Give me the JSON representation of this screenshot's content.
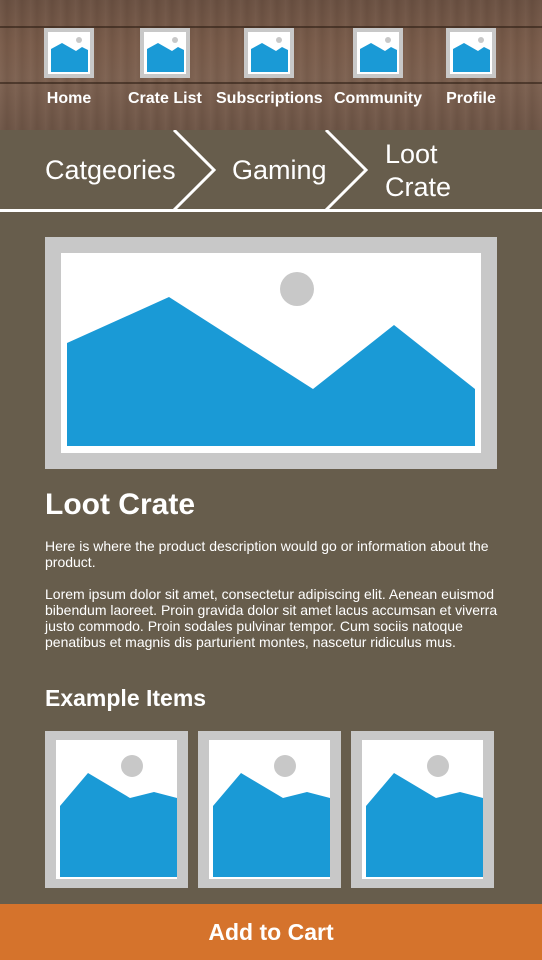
{
  "nav": {
    "items": [
      {
        "label": "Home",
        "icon": "image-placeholder-icon"
      },
      {
        "label": "Crate List",
        "icon": "image-placeholder-icon"
      },
      {
        "label": "Subscriptions",
        "icon": "image-placeholder-icon"
      },
      {
        "label": "Community",
        "icon": "image-placeholder-icon"
      },
      {
        "label": "Profile",
        "icon": "image-placeholder-icon"
      }
    ]
  },
  "breadcrumb": {
    "items": [
      "Catgeories",
      "Gaming",
      "Loot",
      "Crate"
    ]
  },
  "product": {
    "title": "Loot Crate",
    "description": "Here is where the product description would go or information about the product.",
    "lorem": "Lorem ipsum dolor sit amet, consectetur adipiscing elit. Aenean euismod bibendum laoreet. Proin gravida dolor sit amet lacus accumsan et viverra justo commodo. Proin sodales pulvinar tempor. Cum sociis natoque penatibus et magnis dis parturient montes, nascetur ridiculus mus.",
    "hero_icon": "image-placeholder-icon"
  },
  "examples": {
    "title": "Example Items",
    "items": [
      "image-placeholder-icon",
      "image-placeholder-icon",
      "image-placeholder-icon"
    ]
  },
  "cart": {
    "label": "Add to Cart"
  },
  "colors": {
    "background": "#675d4c",
    "accent": "#d5732c",
    "placeholder_frame": "#c8c8c8",
    "placeholder_fill": "#1a9ad6"
  }
}
